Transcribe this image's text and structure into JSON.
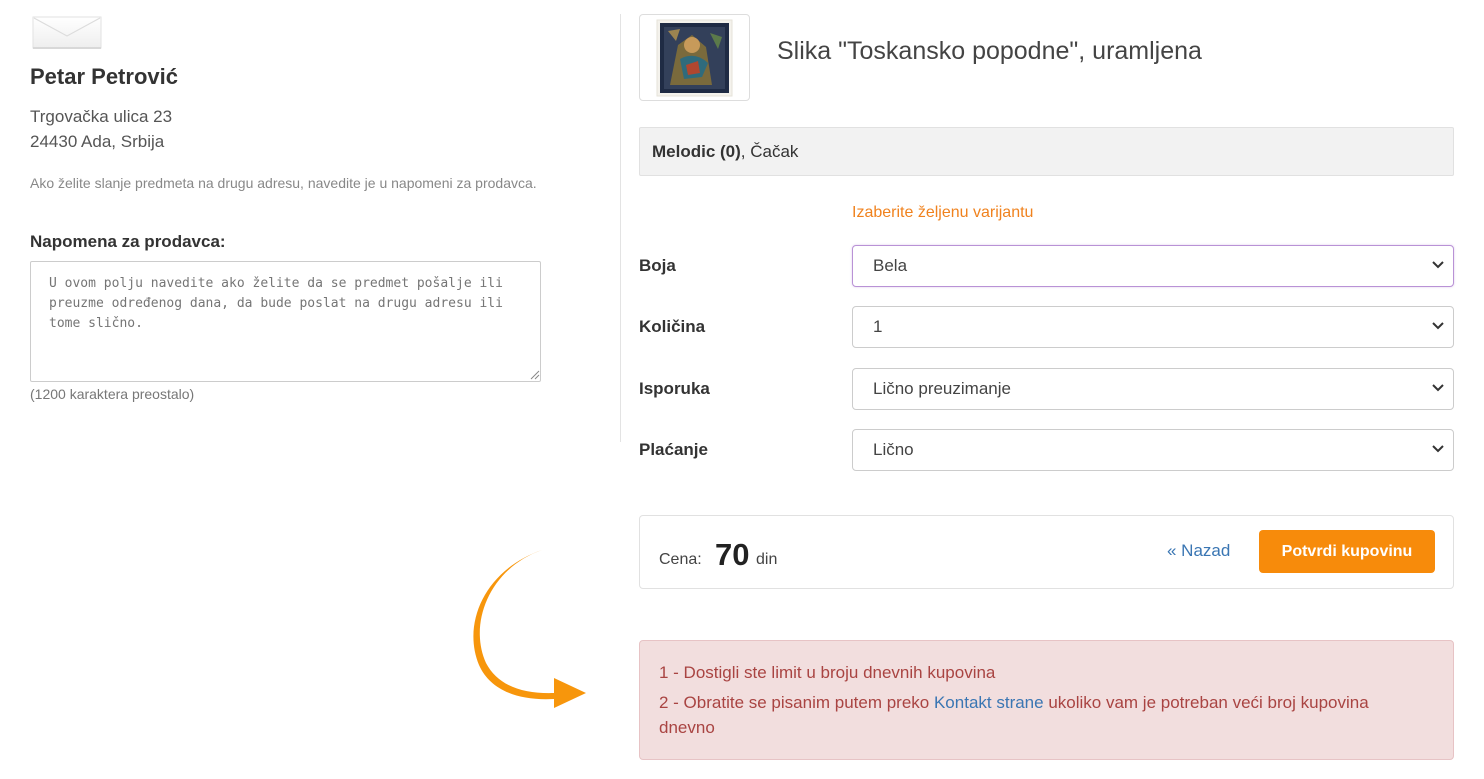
{
  "buyer": {
    "name": "Petar Petrović",
    "address_line1": "Trgovačka ulica 23",
    "address_line2": "24430 Ada, Srbija",
    "hint": "Ako želite slanje predmeta na drugu adresu, navedite je u napomeni za prodavca."
  },
  "note": {
    "label": "Napomena za prodavca:",
    "placeholder": "U ovom polju navedite ako želite da se predmet pošalje ili preuzme određenog dana, da bude poslat na drugu adresu ili tome slično.",
    "value": "",
    "counter": "(1200 karaktera preostalo)"
  },
  "product": {
    "title": "Slika \"Toskansko popodne\", uramljena"
  },
  "seller": {
    "name": "Melodic (0)",
    "separator": ", ",
    "city": "Čačak"
  },
  "form": {
    "variant_hint": "Izaberite željenu varijantu",
    "color": {
      "label": "Boja",
      "value": "Bela"
    },
    "quantity": {
      "label": "Količina",
      "value": "1"
    },
    "delivery": {
      "label": "Isporuka",
      "value": "Lično preuzimanje"
    },
    "payment": {
      "label": "Plaćanje",
      "value": "Lično"
    }
  },
  "price": {
    "label": "Cena:",
    "value": "70",
    "unit": "din"
  },
  "actions": {
    "back_label": "« Nazad",
    "confirm_label": "Potvrdi kupovinu"
  },
  "alert": {
    "line1": "1 - Dostigli ste limit u broju dnevnih kupovina",
    "line2_before": "2 - Obratite se pisanim putem preko ",
    "line2_link": "Kontakt strane",
    "line2_after": " ukoliko vam je potreban veći broj kupovina",
    "line2_wrap": "dnevno"
  },
  "icons": {
    "envelope": "envelope-icon",
    "select_arrow": "chevron-down-icon",
    "callout_arrow": "curved-arrow-icon"
  },
  "colors": {
    "accent_orange": "#f78b0b",
    "hint_orange": "#f0821e",
    "link_blue": "#3a76b3",
    "alert_bg": "#f2dede",
    "alert_text": "#a94442",
    "focus_border": "#b992d6"
  }
}
